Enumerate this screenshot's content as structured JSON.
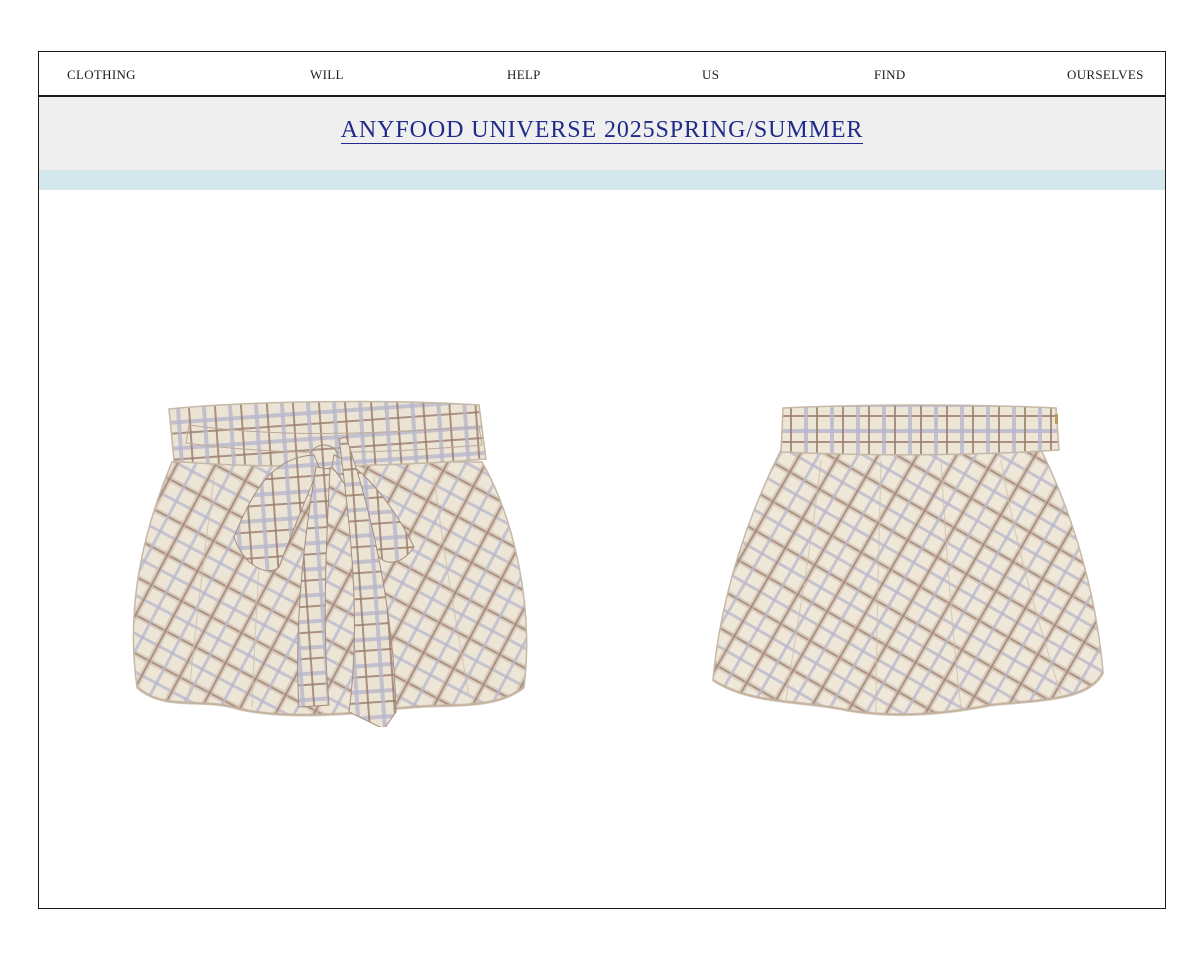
{
  "tagline": {
    "words": [
      "CLOTHING",
      "WILL",
      "HELP",
      "US",
      "FIND",
      "OURSELVES"
    ]
  },
  "banner": {
    "title": "ANYFOOD UNIVERSE 2025SPRING/SUMMER"
  },
  "colors": {
    "title": "#1f2a8a",
    "banner_bg": "#efefef",
    "accent_strip": "#d3e7ec",
    "fabric_base": "#ede6d6",
    "plaid_brown": "#9a7a6a",
    "plaid_lavender": "#b8b6cc"
  },
  "products": [
    {
      "view": "front",
      "icon": "plaid-bubble-skirt-front-with-bow"
    },
    {
      "view": "back",
      "icon": "plaid-bubble-skirt-back"
    }
  ]
}
